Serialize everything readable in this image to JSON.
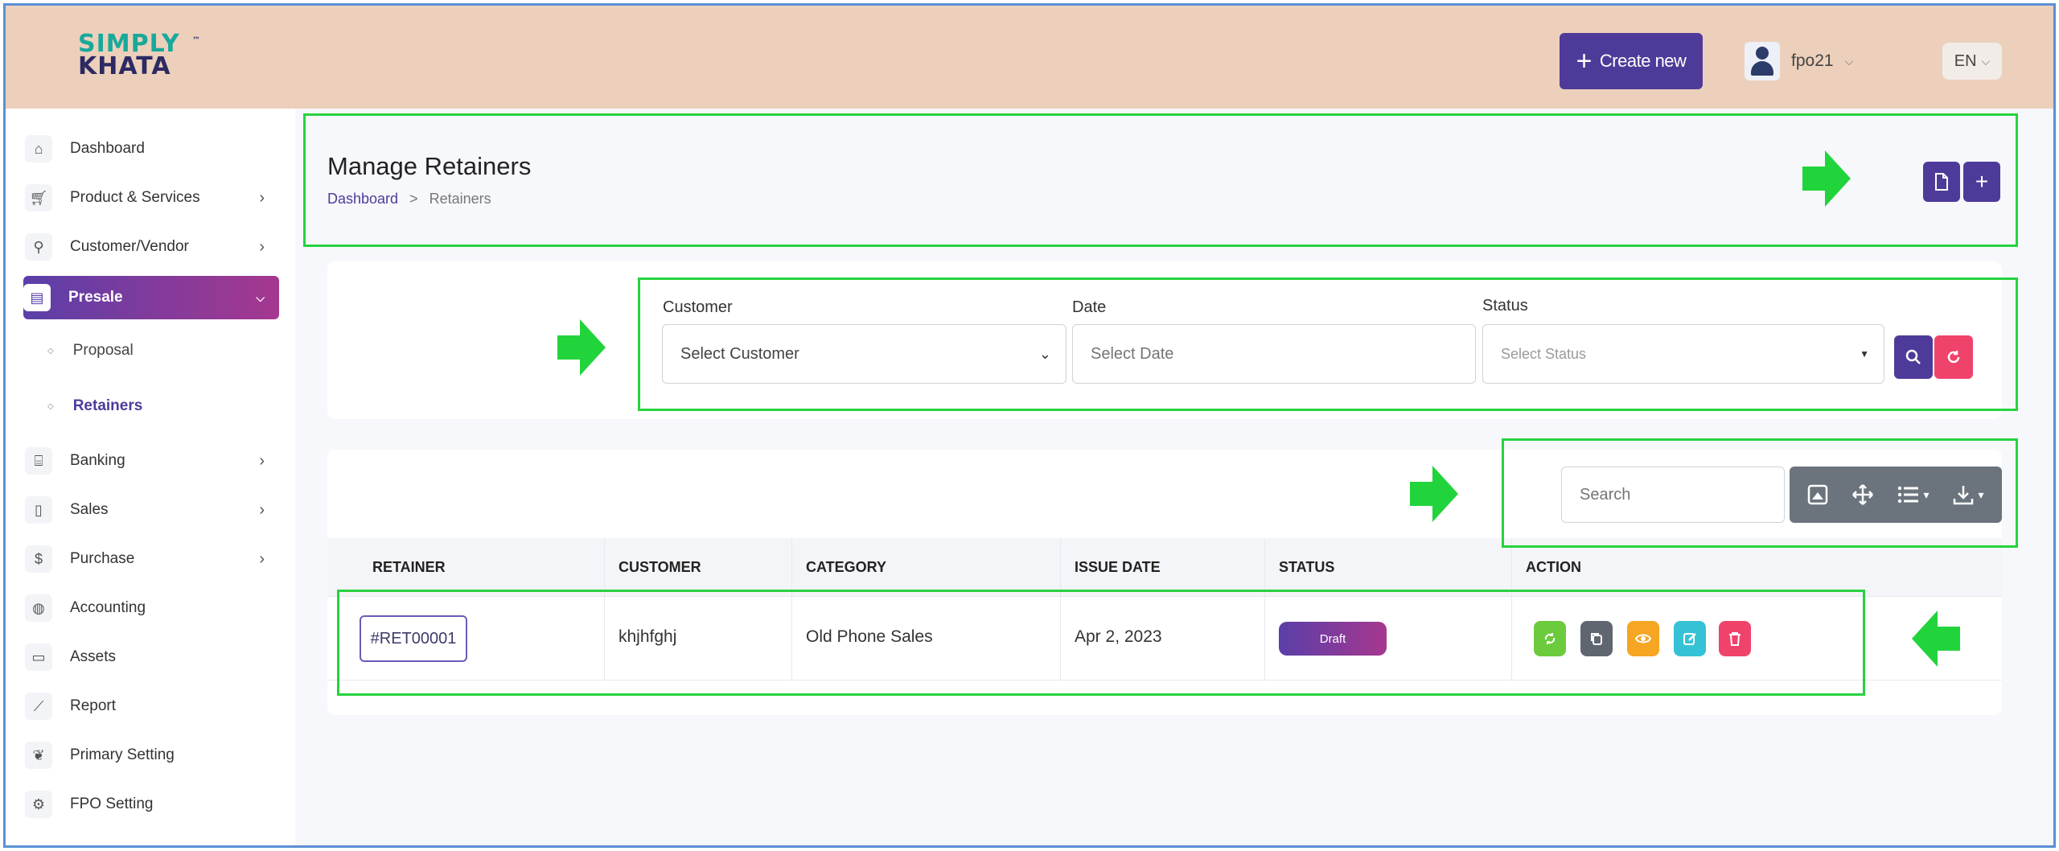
{
  "header": {
    "logo_line1": "SIMPLY",
    "logo_line2": "KHATA",
    "logo_tm": "™",
    "create_label": "Create new",
    "username": "fpo21",
    "language": "EN"
  },
  "sidebar": {
    "items": [
      {
        "label": "Dashboard",
        "icon": "home-icon"
      },
      {
        "label": "Product & Services",
        "icon": "cart-icon"
      },
      {
        "label": "Customer/Vendor",
        "icon": "user-plus-icon"
      },
      {
        "label": "Presale",
        "icon": "building-icon"
      },
      {
        "label": "Banking",
        "icon": "bank-icon"
      },
      {
        "label": "Sales",
        "icon": "file-icon"
      },
      {
        "label": "Purchase",
        "icon": "receipt-icon"
      },
      {
        "label": "Accounting",
        "icon": "globe-icon"
      },
      {
        "label": "Assets",
        "icon": "clipboard-icon"
      },
      {
        "label": "Report",
        "icon": "chart-line-icon"
      },
      {
        "label": "Primary Setting",
        "icon": "leaf-icon"
      },
      {
        "label": "FPO Setting",
        "icon": "gear-icon"
      }
    ],
    "sub_items": [
      {
        "label": "Proposal"
      },
      {
        "label": "Retainers"
      }
    ]
  },
  "page": {
    "title": "Manage Retainers",
    "breadcrumb_home": "Dashboard",
    "breadcrumb_sep": ">",
    "breadcrumb_current": "Retainers"
  },
  "filters": {
    "customer_label": "Customer",
    "customer_value": "Select Customer",
    "date_label": "Date",
    "date_placeholder": "Select Date",
    "status_label": "Status",
    "status_value": "Select Status"
  },
  "table": {
    "search_placeholder": "Search",
    "headers": [
      "RETAINER",
      "CUSTOMER",
      "CATEGORY",
      "ISSUE DATE",
      "STATUS",
      "ACTION"
    ],
    "rows": [
      {
        "retainer": "#RET00001",
        "customer": "khjhfghj",
        "category": "Old Phone Sales",
        "issue_date": "Apr 2, 2023",
        "status": "Draft"
      }
    ]
  },
  "colors": {
    "accent": "#4e3b99",
    "header_bg": "#ecd0bc",
    "highlight": "#27d23f",
    "reset": "#f0436b",
    "act_convert": "#6ccb3c",
    "act_copy": "#5f6670",
    "act_view": "#f6a623",
    "act_edit": "#35c2d6",
    "act_delete": "#f0436b"
  }
}
